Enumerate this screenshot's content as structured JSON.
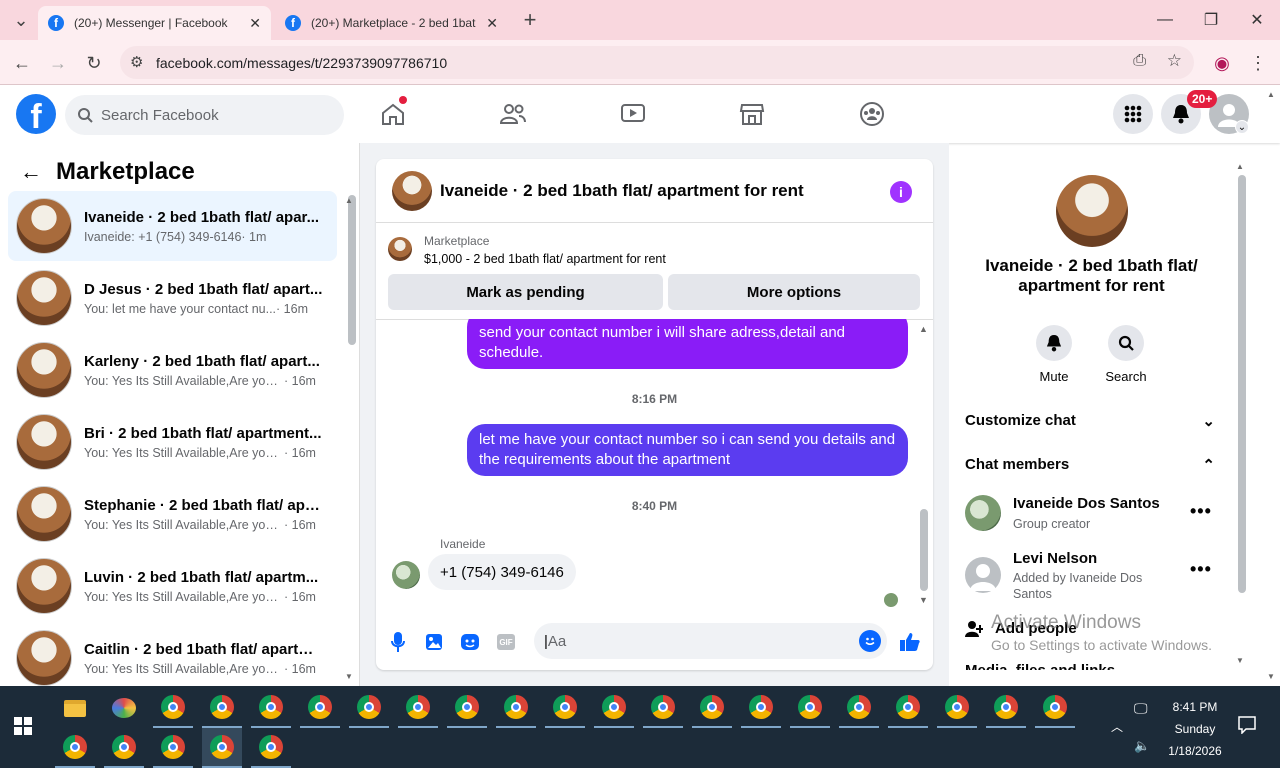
{
  "browser": {
    "tabs": [
      {
        "title": "(20+) Messenger | Facebook",
        "close": "✕"
      },
      {
        "title": "(20+) Marketplace - 2 bed 1bat",
        "close": "✕"
      }
    ],
    "new_tab": "+",
    "url": "facebook.com/messages/t/2293739097786710"
  },
  "fb": {
    "logo": "f",
    "search_placeholder": "Search Facebook",
    "notif_badge": "20+"
  },
  "left": {
    "title": "Marketplace",
    "conversations": [
      {
        "name": "Ivaneide · 2 bed 1bath flat/ apar...",
        "msg": "Ivaneide: +1 (754) 349-6146",
        "time": " · 1m"
      },
      {
        "name": "D Jesus · 2 bed 1bath flat/ apart...",
        "msg": "You: let me have your contact nu...",
        "time": " · 16m"
      },
      {
        "name": "Karleny · 2 bed 1bath flat/ apart...",
        "msg": "You: Yes Its Still Available,Are you ...",
        "time": " · 16m"
      },
      {
        "name": "Bri · 2 bed 1bath flat/ apartment...",
        "msg": "You: Yes Its Still Available,Are you ...",
        "time": " · 16m"
      },
      {
        "name": "Stephanie · 2 bed 1bath flat/ apa...",
        "msg": "You: Yes Its Still Available,Are you ...",
        "time": " · 16m"
      },
      {
        "name": "Luvin · 2 bed 1bath flat/ apartm...",
        "msg": "You: Yes Its Still Available,Are you ...",
        "time": " · 16m"
      },
      {
        "name": "Caitlin · 2 bed 1bath flat/ apartm...",
        "msg": "You: Yes Its Still Available,Are you ...",
        "time": " · 16m"
      }
    ]
  },
  "chat": {
    "title": "Ivaneide · 2 bed 1bath flat/ apartment for rent",
    "info": "i",
    "marketplace_label": "Marketplace",
    "listing": "$1,000 - 2 bed 1bath flat/ apartment for rent",
    "mark_pending": "Mark as pending",
    "more_options": "More options",
    "msg1": "send your contact number i will share adress,detail and schedule.",
    "time1": "8:16 PM",
    "msg2": "let me have your contact number so i can send you details and the requirements about the apartment",
    "time2": "8:40 PM",
    "sender": "Ivaneide",
    "reply": "+1 (754) 349-6146",
    "composer_placeholder": "Aa"
  },
  "right": {
    "name": "Ivaneide · 2 bed 1bath flat/ apartment for rent",
    "mute": "Mute",
    "search": "Search",
    "customize": "Customize chat",
    "members_header": "Chat members",
    "members": [
      {
        "name": "Ivaneide Dos Santos",
        "sub": "Group creator"
      },
      {
        "name": "Levi Nelson",
        "sub": "Added by Ivaneide Dos Santos"
      }
    ],
    "add_people": "Add people",
    "media": "Media, files and links"
  },
  "watermark": {
    "line1": "Activate Windows",
    "line2": "Go to Settings to activate Windows."
  },
  "taskbar": {
    "time": "8:41 PM",
    "day": "Sunday",
    "date": "1/18/2026"
  },
  "colors": {
    "fb_blue": "#1877f2",
    "bubble_purple": "#8a1cf7",
    "bubble_indigo": "#5b3cf0",
    "taskbar": "#1c2b39"
  }
}
